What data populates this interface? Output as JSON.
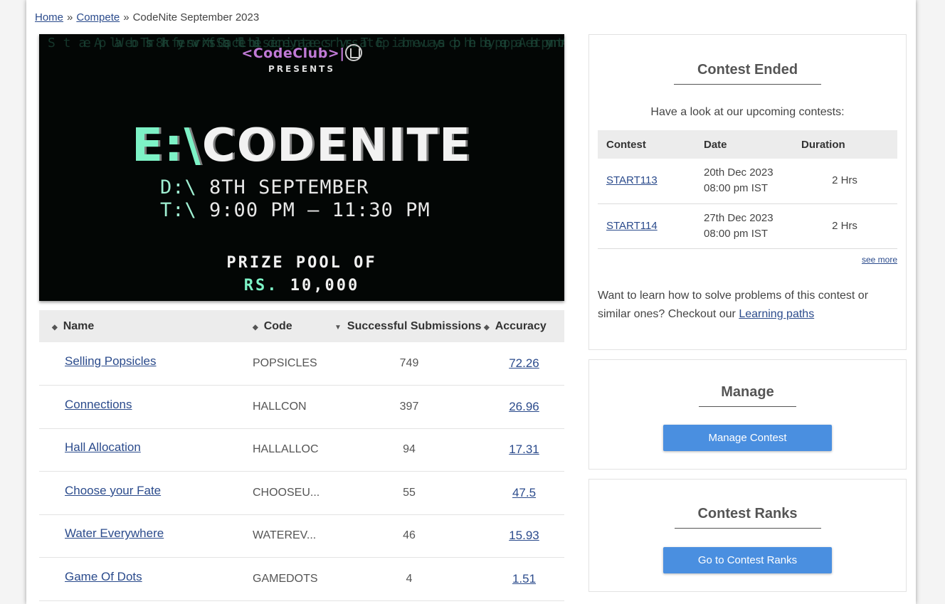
{
  "breadcrumb": {
    "home": "Home",
    "sep1": "»",
    "compete": "Compete",
    "sep2": "»",
    "current": "CodeNite September 2023"
  },
  "banner": {
    "brand": "<CodeClub>",
    "pipe": "|",
    "presents": "PRESENTS",
    "title_drive": "E:\\",
    "title_name": "CODENITE",
    "date_prefix": "D:\\",
    "date_value": "8TH SEPTEMBER",
    "time_prefix": "T:\\",
    "time_value": "9:00 PM – 11:30 PM",
    "prize_line1": "PRIZE POOL OF",
    "prize_rs": "RS.",
    "prize_amount": "10,000"
  },
  "problems": {
    "columns": {
      "name": "Name",
      "code": "Code",
      "successful_submissions": "Successful Submissions",
      "accuracy": "Accuracy"
    },
    "rows": [
      {
        "name": "Selling Popsicles",
        "code": "POPSICLES",
        "submissions": "749",
        "accuracy": "72.26"
      },
      {
        "name": "Connections",
        "code": "HALLCON",
        "submissions": "397",
        "accuracy": "26.96"
      },
      {
        "name": "Hall Allocation",
        "code": "HALLALLOC",
        "submissions": "94",
        "accuracy": "17.31"
      },
      {
        "name": "Choose your Fate",
        "code": "CHOOSEU...",
        "submissions": "55",
        "accuracy": "47.5"
      },
      {
        "name": "Water Everywhere",
        "code": "WATEREV...",
        "submissions": "46",
        "accuracy": "15.93"
      },
      {
        "name": "Game Of Dots",
        "code": "GAMEDOTS",
        "submissions": "4",
        "accuracy": "1.51"
      }
    ]
  },
  "contest_ended": {
    "title": "Contest Ended",
    "upcoming_text": "Have a look at our upcoming contests:",
    "columns": {
      "contest": "Contest",
      "date": "Date",
      "duration": "Duration"
    },
    "rows": [
      {
        "contest": "START113",
        "date": "20th Dec 2023",
        "time": "08:00 pm IST",
        "duration": "2 Hrs"
      },
      {
        "contest": "START114",
        "date": "27th Dec 2023",
        "time": "08:00 pm IST",
        "duration": "2 Hrs"
      }
    ],
    "see_more": "see more",
    "learn_text": "Want to learn how to solve problems of this contest or similar ones? Checkout our",
    "learn_link": "Learning paths"
  },
  "manage": {
    "title": "Manage",
    "button": "Manage Contest"
  },
  "ranks": {
    "title": "Contest Ranks",
    "button": "Go to Contest Ranks"
  },
  "colors": {
    "link": "#2b4b8c",
    "button": "#4a8fe0",
    "banner_bg": "#030605",
    "banner_accent": "#7df2c6",
    "brand": "#c07ad6"
  }
}
